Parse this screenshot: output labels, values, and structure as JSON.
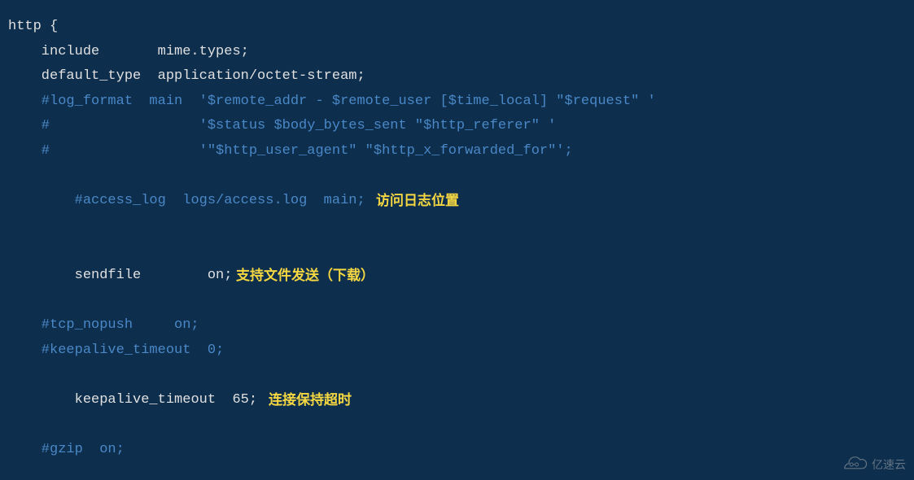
{
  "code": {
    "line1": "http {",
    "line2": "    include       mime.types;",
    "line3": "    default_type  application/octet-stream;",
    "line4": "",
    "line5": "    #log_format  main  '$remote_addr - $remote_user [$time_local] \"$request\" '",
    "line6": "    #                  '$status $body_bytes_sent \"$http_referer\" '",
    "line7": "    #                  '\"$http_user_agent\" \"$http_x_forwarded_for\"';",
    "line8": "",
    "line9": "    #access_log  logs/access.log  main;",
    "line10": "",
    "line11a": "    sendfile        on;",
    "line12": "    #tcp_nopush     on;",
    "line13": "",
    "line14": "    #keepalive_timeout  0;",
    "line15": "    keepalive_timeout  65;",
    "line16": "",
    "line17": "    #gzip  on;"
  },
  "annotations": {
    "access_log": "访问日志位置",
    "sendfile": "支持文件发送（下载）",
    "keepalive": "连接保持超时"
  },
  "watermark": {
    "text": "亿速云"
  }
}
